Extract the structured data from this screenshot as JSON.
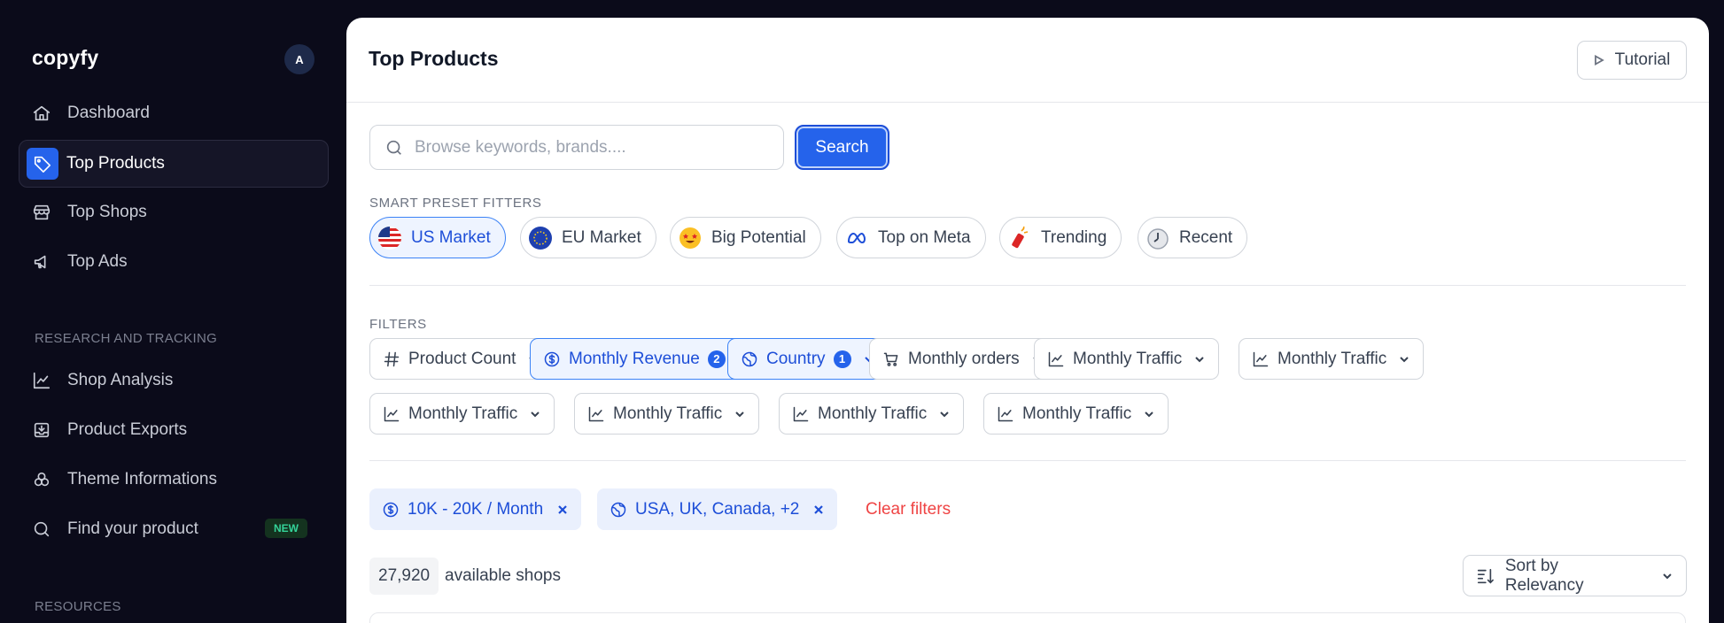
{
  "brand": {
    "logo": "copyfy",
    "avatar_initial": "A"
  },
  "sidebar": {
    "items": [
      {
        "label": "Dashboard",
        "icon": "home-icon"
      },
      {
        "label": "Top Products",
        "icon": "tag-icon",
        "active": true
      },
      {
        "label": "Top Shops",
        "icon": "store-icon"
      },
      {
        "label": "Top Ads",
        "icon": "megaphone-icon"
      }
    ],
    "research_label": "RESEARCH AND TRACKING",
    "research_items": [
      {
        "label": "Shop Analysis",
        "icon": "chart-line-icon"
      },
      {
        "label": "Product Exports",
        "icon": "export-icon"
      },
      {
        "label": "Theme Informations",
        "icon": "theme-icon"
      },
      {
        "label": "Find your product",
        "icon": "search-icon",
        "badge": "NEW"
      }
    ],
    "resources_label": "RESOURCES"
  },
  "header": {
    "title": "Top Products",
    "tutorial_label": "Tutorial"
  },
  "search": {
    "placeholder": "Browse keywords, brands....",
    "value": "",
    "button_label": "Search"
  },
  "presets": {
    "label": "SMART PRESET FITTERS",
    "items": [
      {
        "label": "US Market",
        "icon": "us-flag-icon",
        "active": true
      },
      {
        "label": "EU Market",
        "icon": "eu-flag-icon"
      },
      {
        "label": "Big Potential",
        "icon": "star-struck-emoji-icon"
      },
      {
        "label": "Top on Meta",
        "icon": "meta-logo-icon"
      },
      {
        "label": "Trending",
        "icon": "firecracker-icon"
      },
      {
        "label": "Recent",
        "icon": "stopwatch-icon"
      }
    ]
  },
  "filters": {
    "label": "FILTERS",
    "items": [
      {
        "label": "Product Count",
        "icon": "hash-icon"
      },
      {
        "label": "Monthly Revenue",
        "icon": "dollar-circle-icon",
        "count": "2",
        "active": true
      },
      {
        "label": "Country",
        "icon": "globe-icon",
        "count": "1",
        "active": true
      },
      {
        "label": "Monthly orders",
        "icon": "cart-icon"
      },
      {
        "label": "Monthly Traffic",
        "icon": "chart-line-icon"
      },
      {
        "label": "Monthly Traffic",
        "icon": "chart-line-icon"
      },
      {
        "label": "Monthly Traffic",
        "icon": "chart-line-icon"
      },
      {
        "label": "Monthly Traffic",
        "icon": "chart-line-icon"
      },
      {
        "label": "Monthly Traffic",
        "icon": "chart-line-icon"
      },
      {
        "label": "Monthly Traffic",
        "icon": "chart-line-icon"
      }
    ]
  },
  "active_filters": {
    "chips": [
      {
        "label": "10K - 20K / Month",
        "icon": "dollar-circle-icon"
      },
      {
        "label": "USA, UK, Canada, +2",
        "icon": "globe-icon"
      }
    ],
    "clear_label": "Clear filters"
  },
  "results": {
    "count": "27,920",
    "count_suffix": "available shops",
    "sort_label": "Sort by Relevancy"
  },
  "colors": {
    "accent": "#2563eb",
    "sidebar_bg": "#0b0b1a",
    "danger": "#ef4444",
    "new_badge": "#34d399"
  }
}
